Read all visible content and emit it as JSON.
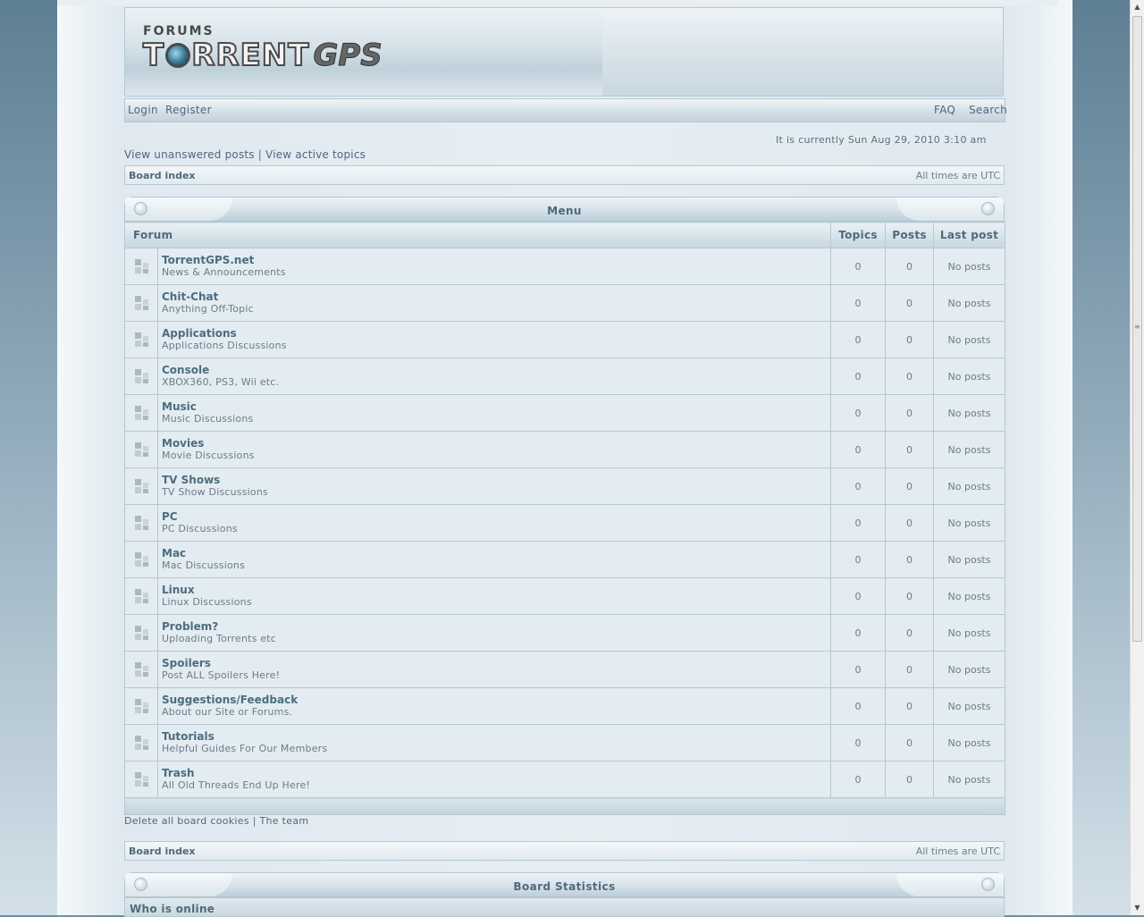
{
  "header": {
    "logo_forums": "FORUMS",
    "logo_torrent_t": "T",
    "logo_torrent_rest": "RRENT",
    "logo_gps": "GPS"
  },
  "navbar": {
    "login": "Login",
    "register": "Register",
    "faq": "FAQ",
    "search": "Search"
  },
  "datetime": "It is currently Sun Aug 29, 2010 3:10 am",
  "quicklinks": {
    "unanswered": "View unanswered posts",
    "separator": "|",
    "active": "View active topics"
  },
  "breadcrumb": {
    "board_index": "Board index",
    "timezone": "All times are UTC"
  },
  "category": {
    "title": "Menu",
    "columns": {
      "forum": "Forum",
      "topics": "Topics",
      "posts": "Posts",
      "last_post": "Last post"
    },
    "forums": [
      {
        "name": "TorrentGPS.net",
        "desc": "News & Announcements",
        "topics": "0",
        "posts": "0",
        "last": "No posts"
      },
      {
        "name": "Chit-Chat",
        "desc": "Anything Off-Topic",
        "topics": "0",
        "posts": "0",
        "last": "No posts"
      },
      {
        "name": "Applications",
        "desc": "Applications Discussions",
        "topics": "0",
        "posts": "0",
        "last": "No posts"
      },
      {
        "name": "Console",
        "desc": "XBOX360, PS3, Wii etc.",
        "topics": "0",
        "posts": "0",
        "last": "No posts"
      },
      {
        "name": "Music",
        "desc": "Music Discussions",
        "topics": "0",
        "posts": "0",
        "last": "No posts"
      },
      {
        "name": "Movies",
        "desc": "Movie Discussions",
        "topics": "0",
        "posts": "0",
        "last": "No posts"
      },
      {
        "name": "TV Shows",
        "desc": "TV Show Discussions",
        "topics": "0",
        "posts": "0",
        "last": "No posts"
      },
      {
        "name": "PC",
        "desc": "PC Discussions",
        "topics": "0",
        "posts": "0",
        "last": "No posts"
      },
      {
        "name": "Mac",
        "desc": "Mac Discussions",
        "topics": "0",
        "posts": "0",
        "last": "No posts"
      },
      {
        "name": "Linux",
        "desc": "Linux Discussions",
        "topics": "0",
        "posts": "0",
        "last": "No posts"
      },
      {
        "name": "Problem?",
        "desc": "Uploading Torrents etc",
        "topics": "0",
        "posts": "0",
        "last": "No posts"
      },
      {
        "name": "Spoilers",
        "desc": "Post ALL Spoilers Here!",
        "topics": "0",
        "posts": "0",
        "last": "No posts"
      },
      {
        "name": "Suggestions/Feedback",
        "desc": "About our Site or Forums.",
        "topics": "0",
        "posts": "0",
        "last": "No posts"
      },
      {
        "name": "Tutorials",
        "desc": "Helpful Guides For Our Members",
        "topics": "0",
        "posts": "0",
        "last": "No posts"
      },
      {
        "name": "Trash",
        "desc": "All Old Threads End Up Here!",
        "topics": "0",
        "posts": "0",
        "last": "No posts"
      }
    ]
  },
  "footer_links": {
    "delete_cookies": "Delete all board cookies",
    "separator": "|",
    "team": "The team"
  },
  "stats": {
    "title": "Board Statistics",
    "who_online": "Who is online"
  },
  "colors": {
    "link": "#536482",
    "forum_name": "#4c6d80",
    "row_bg": "#e3ecf1",
    "border": "#b6c8d3"
  }
}
